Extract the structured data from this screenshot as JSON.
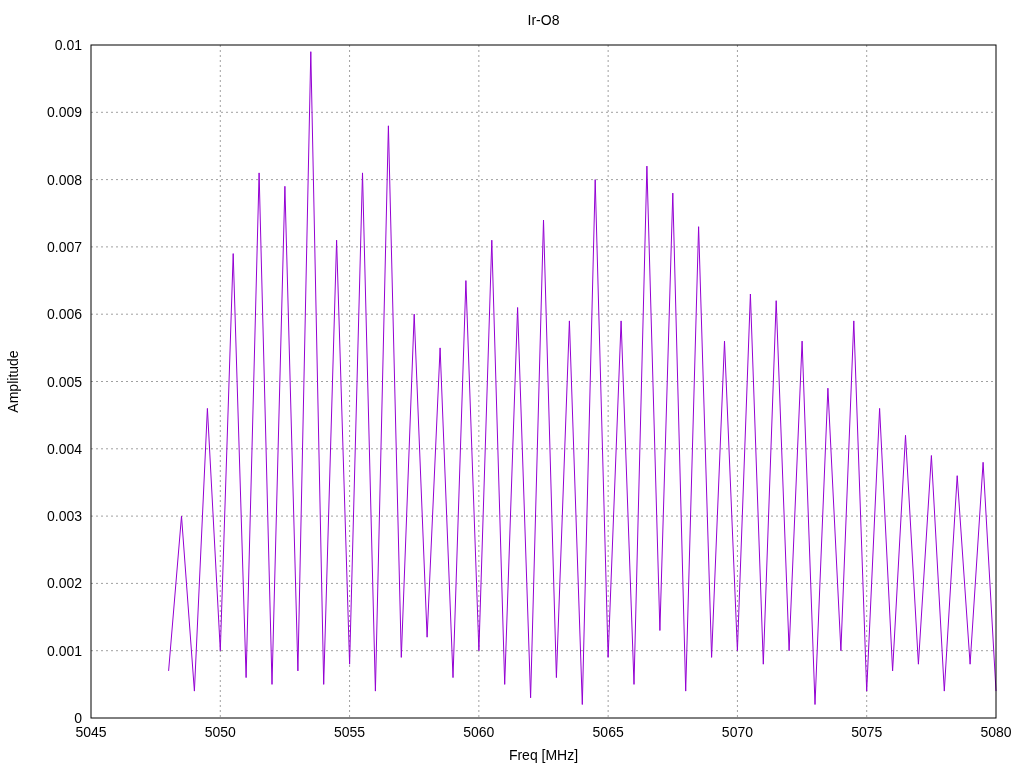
{
  "chart_data": {
    "type": "line",
    "grid": true,
    "title": "Ir-O8",
    "xlabel": "Freq [MHz]",
    "ylabel": "Amplitude",
    "xlim": [
      5045,
      5080
    ],
    "ylim": [
      0,
      0.01
    ],
    "xticks": [
      5045,
      5050,
      5055,
      5060,
      5065,
      5070,
      5075,
      5080
    ],
    "yticks": [
      {
        "value": 0,
        "label": "0"
      },
      {
        "value": 0.001,
        "label": "0.001"
      },
      {
        "value": 0.002,
        "label": "0.002"
      },
      {
        "value": 0.003,
        "label": "0.003"
      },
      {
        "value": 0.004,
        "label": "0.004"
      },
      {
        "value": 0.005,
        "label": "0.005"
      },
      {
        "value": 0.006,
        "label": "0.006"
      },
      {
        "value": 0.007,
        "label": "0.007"
      },
      {
        "value": 0.008,
        "label": "0.008"
      },
      {
        "value": 0.009,
        "label": "0.009"
      },
      {
        "value": 0.01,
        "label": "0.01"
      }
    ],
    "x": [
      5048,
      5048.5,
      5049,
      5049.5,
      5050,
      5050.5,
      5051,
      5051.5,
      5052,
      5052.5,
      5053,
      5053.5,
      5054,
      5054.5,
      5055,
      5055.5,
      5056,
      5056.5,
      5057,
      5057.5,
      5058,
      5058.5,
      5059,
      5059.5,
      5060,
      5060.5,
      5061,
      5061.5,
      5062,
      5062.5,
      5063,
      5063.5,
      5064,
      5064.5,
      5065,
      5065.5,
      5066,
      5066.5,
      5067,
      5067.5,
      5068,
      5068.5,
      5069,
      5069.5,
      5070,
      5070.5,
      5071,
      5071.5,
      5072,
      5072.5,
      5073,
      5073.5,
      5074,
      5074.5,
      5075,
      5075.5,
      5076,
      5076.5,
      5077,
      5077.5,
      5078,
      5078.5,
      5079,
      5079.5,
      5080
    ],
    "series": [
      {
        "color": "#9400d3",
        "values": [
          0.0007,
          0.003,
          0.0004,
          0.0046,
          0.001,
          0.0069,
          0.0006,
          0.0081,
          0.0005,
          0.0079,
          0.0007,
          0.0099,
          0.0005,
          0.0071,
          0.0008,
          0.0081,
          0.0004,
          0.0088,
          0.0009,
          0.006,
          0.0012,
          0.0055,
          0.0006,
          0.0065,
          0.001,
          0.0071,
          0.0005,
          0.0061,
          0.0003,
          0.0074,
          0.0006,
          0.0059,
          0.0002,
          0.008,
          0.0009,
          0.0059,
          0.0005,
          0.0082,
          0.0013,
          0.0078,
          0.0004,
          0.0073,
          0.0009,
          0.0056,
          0.001,
          0.0063,
          0.0008,
          0.0062,
          0.001,
          0.0056,
          0.0002,
          0.0049,
          0.001,
          0.0059,
          0.0004,
          0.0046,
          0.0007,
          0.0042,
          0.0008,
          0.0039,
          0.0004,
          0.0036,
          0.0008,
          0.0038,
          0.0004
        ]
      }
    ]
  }
}
